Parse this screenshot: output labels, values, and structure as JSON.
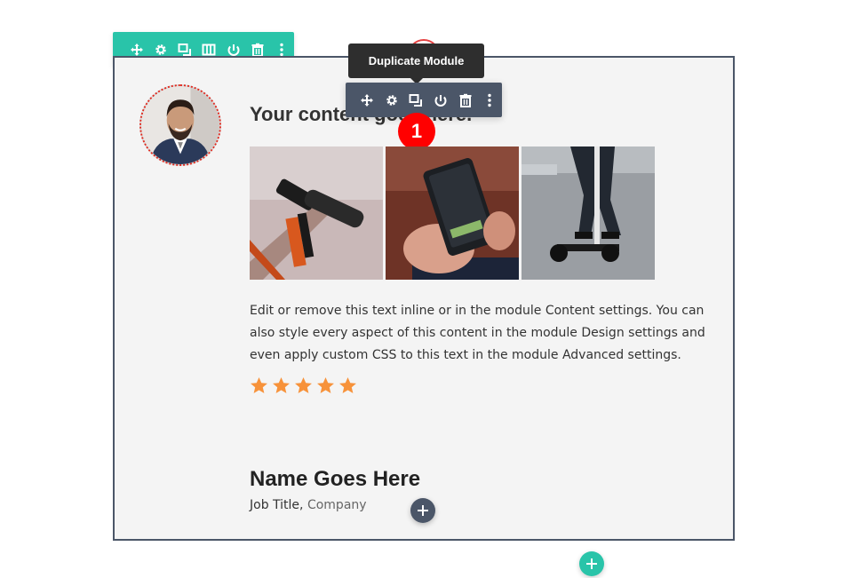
{
  "colors": {
    "row_toolbar_bg": "#29c4a9",
    "module_toolbar_bg": "#4b5668",
    "section_border": "#4b5668",
    "section_bg": "#f4f4f4",
    "star_color": "#f7923a",
    "step_badge": "#ff0000",
    "tooltip_bg": "#2e2e2e"
  },
  "row_toolbar": {
    "icons": [
      "move-icon",
      "settings-icon",
      "duplicate-icon",
      "columns-icon",
      "save-icon",
      "delete-icon",
      "more-icon"
    ]
  },
  "module_toolbar": {
    "icons": [
      "move-icon",
      "settings-icon",
      "duplicate-icon",
      "save-icon",
      "delete-icon",
      "more-icon"
    ]
  },
  "tooltip": {
    "label": "Duplicate Module"
  },
  "step_badge": {
    "label": "1"
  },
  "module": {
    "title": "Your content goes here.",
    "body": "Edit or remove this text inline or in the module Content settings. You can also style every aspect of this content in the module Design settings and even apply custom CSS to this text in the module Advanced settings.",
    "rating": 5,
    "gallery": [
      "scooter-handlebar-image",
      "phone-app-image",
      "person-on-scooter-image"
    ]
  },
  "testimonial": {
    "name": "Name Goes Here",
    "job_title": "Job Title",
    "separator": ", ",
    "company": "Company"
  },
  "buttons": {
    "add_module_icon": "plus-icon",
    "add_row_icon": "plus-icon"
  }
}
